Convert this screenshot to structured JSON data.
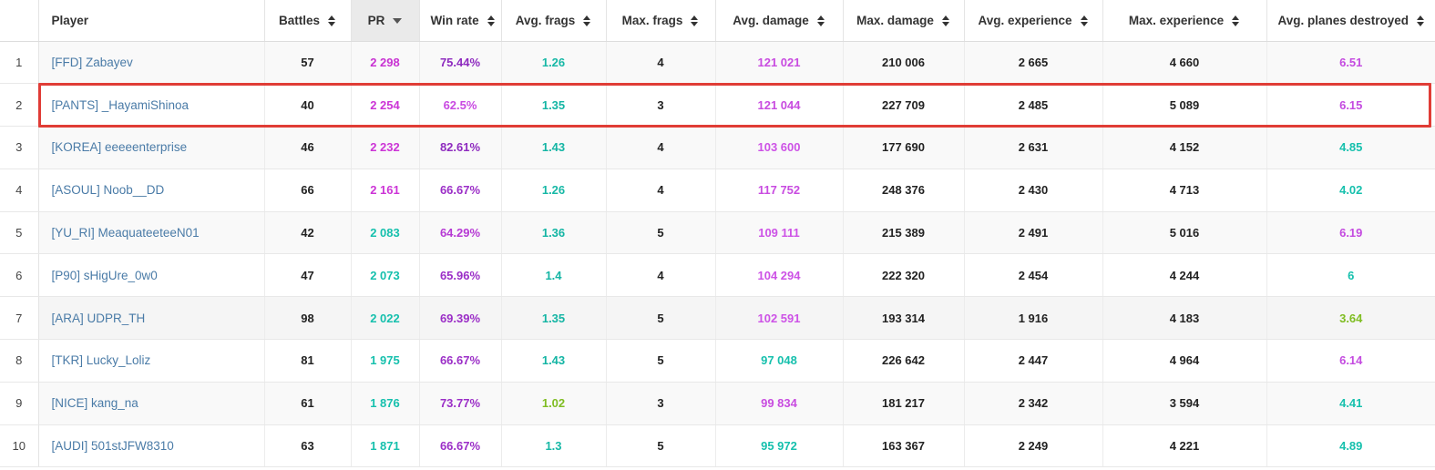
{
  "table": {
    "columns": [
      {
        "key": "rank",
        "label": "",
        "sortable": false,
        "sorted": false
      },
      {
        "key": "player",
        "label": "Player",
        "sortable": false,
        "sorted": false
      },
      {
        "key": "battles",
        "label": "Battles",
        "sortable": true,
        "sorted": false
      },
      {
        "key": "pr",
        "label": "PR",
        "sortable": true,
        "sorted": true
      },
      {
        "key": "winrate",
        "label": "Win rate",
        "sortable": true,
        "sorted": false
      },
      {
        "key": "avgfrag",
        "label": "Avg. frags",
        "sortable": true,
        "sorted": false
      },
      {
        "key": "maxfrag",
        "label": "Max. frags",
        "sortable": true,
        "sorted": false
      },
      {
        "key": "avgdmg",
        "label": "Avg. damage",
        "sortable": true,
        "sorted": false
      },
      {
        "key": "maxdmg",
        "label": "Max. damage",
        "sortable": true,
        "sorted": false
      },
      {
        "key": "avgexp",
        "label": "Avg. experience",
        "sortable": true,
        "sorted": false
      },
      {
        "key": "maxexp",
        "label": "Max. experience",
        "sortable": true,
        "sorted": false
      },
      {
        "key": "avgpd",
        "label": "Avg. planes destroyed",
        "sortable": true,
        "sorted": false
      }
    ],
    "sort": {
      "column": "PR",
      "direction": "desc",
      "icon": "caret-down-icon"
    },
    "highlighted_row_rank": "2",
    "hovered_row_rank": "7",
    "rows": [
      {
        "rank": "1",
        "player": "[FFD] Zabayev",
        "battles": "57",
        "pr": "2 298",
        "pr_color": "#c832d2",
        "winrate": "75.44%",
        "winrate_color": "#8e2bbf",
        "avgfrag": "1.26",
        "avgfrag_color": "#17b8a6",
        "maxfrag": "4",
        "avgdmg": "121 021",
        "avgdmg_color": "#c84be0",
        "maxdmg": "210 006",
        "avgexp": "2 665",
        "maxexp": "4 660",
        "avgpd": "6.51",
        "avgpd_color": "#c44be0"
      },
      {
        "rank": "2",
        "player": "[PANTS] _HayamiShinoa",
        "battles": "40",
        "pr": "2 254",
        "pr_color": "#cc34d6",
        "winrate": "62.5%",
        "winrate_color": "#c94ae2",
        "avgfrag": "1.35",
        "avgfrag_color": "#14b5a4",
        "maxfrag": "3",
        "avgdmg": "121 044",
        "avgdmg_color": "#c84be0",
        "maxdmg": "227 709",
        "avgexp": "2 485",
        "maxexp": "5 089",
        "avgpd": "6.15",
        "avgpd_color": "#c44be0"
      },
      {
        "rank": "3",
        "player": "[KOREA] eeeeenterprise",
        "battles": "46",
        "pr": "2 232",
        "pr_color": "#cc34d6",
        "winrate": "82.61%",
        "winrate_color": "#8e2bbf",
        "avgfrag": "1.43",
        "avgfrag_color": "#14b5a4",
        "maxfrag": "4",
        "avgdmg": "103 600",
        "avgdmg_color": "#cd52e6",
        "maxdmg": "177 690",
        "avgexp": "2 631",
        "maxexp": "4 152",
        "avgpd": "4.85",
        "avgpd_color": "#16c0ad"
      },
      {
        "rank": "4",
        "player": "[ASOUL] Noob__DD",
        "battles": "66",
        "pr": "2 161",
        "pr_color": "#cc34d6",
        "winrate": "66.67%",
        "winrate_color": "#9b2ec7",
        "avgfrag": "1.26",
        "avgfrag_color": "#17b8a6",
        "maxfrag": "4",
        "avgdmg": "117 752",
        "avgdmg_color": "#c84be0",
        "maxdmg": "248 376",
        "avgexp": "2 430",
        "maxexp": "4 713",
        "avgpd": "4.02",
        "avgpd_color": "#16c0ad"
      },
      {
        "rank": "5",
        "player": "[YU_RI] MeaquateeteeN01",
        "battles": "42",
        "pr": "2 083",
        "pr_color": "#16c0ad",
        "winrate": "64.29%",
        "winrate_color": "#b63ad4",
        "avgfrag": "1.36",
        "avgfrag_color": "#14b5a4",
        "maxfrag": "5",
        "avgdmg": "109 111",
        "avgdmg_color": "#cd52e6",
        "maxdmg": "215 389",
        "avgexp": "2 491",
        "maxexp": "5 016",
        "avgpd": "6.19",
        "avgpd_color": "#c44be0"
      },
      {
        "rank": "6",
        "player": "[P90] sHigUre_0w0",
        "battles": "47",
        "pr": "2 073",
        "pr_color": "#16c0ad",
        "winrate": "65.96%",
        "winrate_color": "#9b2ec7",
        "avgfrag": "1.4",
        "avgfrag_color": "#14b5a4",
        "maxfrag": "4",
        "avgdmg": "104 294",
        "avgdmg_color": "#cd52e6",
        "maxdmg": "222 320",
        "avgexp": "2 454",
        "maxexp": "4 244",
        "avgpd": "6",
        "avgpd_color": "#16c0ad"
      },
      {
        "rank": "7",
        "player": "[ARA] UDPR_TH",
        "battles": "98",
        "pr": "2 022",
        "pr_color": "#16c0ad",
        "winrate": "69.39%",
        "winrate_color": "#9b2ec7",
        "avgfrag": "1.35",
        "avgfrag_color": "#14b5a4",
        "maxfrag": "5",
        "avgdmg": "102 591",
        "avgdmg_color": "#cd52e6",
        "maxdmg": "193 314",
        "avgexp": "1 916",
        "maxexp": "4 183",
        "avgpd": "3.64",
        "avgpd_color": "#7fbd22"
      },
      {
        "rank": "8",
        "player": "[TKR] Lucky_Loliz",
        "battles": "81",
        "pr": "1 975",
        "pr_color": "#16c0ad",
        "winrate": "66.67%",
        "winrate_color": "#9b2ec7",
        "avgfrag": "1.43",
        "avgfrag_color": "#14b5a4",
        "maxfrag": "5",
        "avgdmg": "97 048",
        "avgdmg_color": "#16c0ad",
        "maxdmg": "226 642",
        "avgexp": "2 447",
        "maxexp": "4 964",
        "avgpd": "6.14",
        "avgpd_color": "#c44be0"
      },
      {
        "rank": "9",
        "player": "[NICE] kang_na",
        "battles": "61",
        "pr": "1 876",
        "pr_color": "#16c0ad",
        "winrate": "73.77%",
        "winrate_color": "#9b2ec7",
        "avgfrag": "1.02",
        "avgfrag_color": "#7fbd22",
        "maxfrag": "3",
        "avgdmg": "99 834",
        "avgdmg_color": "#c84be0",
        "maxdmg": "181 217",
        "avgexp": "2 342",
        "maxexp": "3 594",
        "avgpd": "4.41",
        "avgpd_color": "#16c0ad"
      },
      {
        "rank": "10",
        "player": "[AUDI] 501stJFW8310",
        "battles": "63",
        "pr": "1 871",
        "pr_color": "#16c0ad",
        "winrate": "66.67%",
        "winrate_color": "#9b2ec7",
        "avgfrag": "1.3",
        "avgfrag_color": "#17b8a6",
        "maxfrag": "5",
        "avgdmg": "95 972",
        "avgdmg_color": "#16c0ad",
        "maxdmg": "163 367",
        "avgexp": "2 249",
        "maxexp": "4 221",
        "avgpd": "4.89",
        "avgpd_color": "#16c0ad"
      }
    ]
  },
  "colors": {
    "highlight_border": "#e03c36",
    "link": "#4a7ba7",
    "header_sorted_bg": "#eaeaea",
    "row_odd_bg": "#f9f9f9",
    "row_even_bg": "#ffffff"
  }
}
